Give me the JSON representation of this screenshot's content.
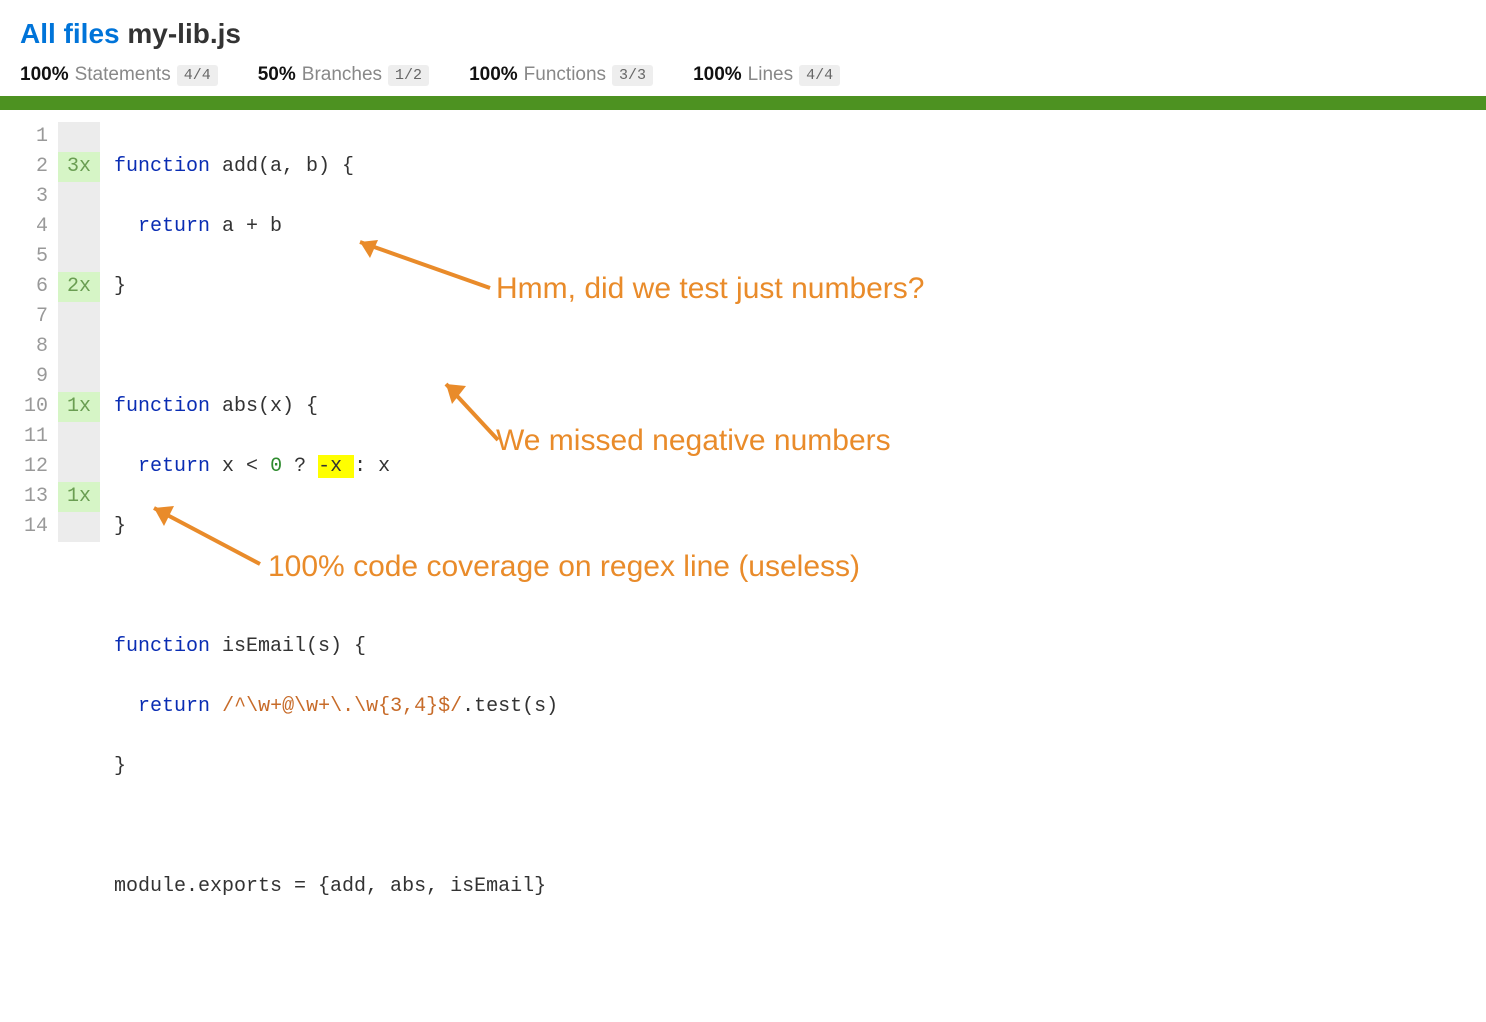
{
  "breadcrumb": {
    "root": "All files",
    "filename": "my-lib.js"
  },
  "stats": {
    "statements": {
      "pct": "100%",
      "label": "Statements",
      "frac": "4/4"
    },
    "branches": {
      "pct": "50%",
      "label": "Branches",
      "frac": "1/2"
    },
    "functions": {
      "pct": "100%",
      "label": "Functions",
      "frac": "3/3"
    },
    "lines": {
      "pct": "100%",
      "label": "Lines",
      "frac": "4/4"
    }
  },
  "code": {
    "line_numbers": [
      "1",
      "2",
      "3",
      "4",
      "5",
      "6",
      "7",
      "8",
      "9",
      "10",
      "11",
      "12",
      "13",
      "14"
    ],
    "counts": [
      "",
      "3x",
      "",
      "",
      "",
      "2x",
      "",
      "",
      "",
      "1x",
      "",
      "",
      "1x",
      ""
    ],
    "src": {
      "l1_kw": "function",
      "l1_rest": " add(a, b) {",
      "l2_ret": "return",
      "l2_rest": " a + b",
      "l3": "}",
      "l5_kw": "function",
      "l5_rest": " abs(x) {",
      "l6_ret": "return",
      "l6_a": " x < ",
      "l6_zero": "0",
      "l6_b": " ? ",
      "l6_miss": "-x ",
      "l6_c": ": x",
      "l7": "}",
      "l9_kw": "function",
      "l9_rest": " isEmail(s) {",
      "l10_ret": "return",
      "l10_sp": " ",
      "l10_regex": "/^\\w+@\\w+\\.\\w{3,4}$/",
      "l10_rest": ".test(s)",
      "l11": "}",
      "l13": "module.exports = {add, abs, isEmail}"
    }
  },
  "annotations": {
    "a1": "Hmm, did we test just numbers?",
    "a2": "We missed negative numbers",
    "a3": "100% code coverage on regex line (useless)"
  }
}
